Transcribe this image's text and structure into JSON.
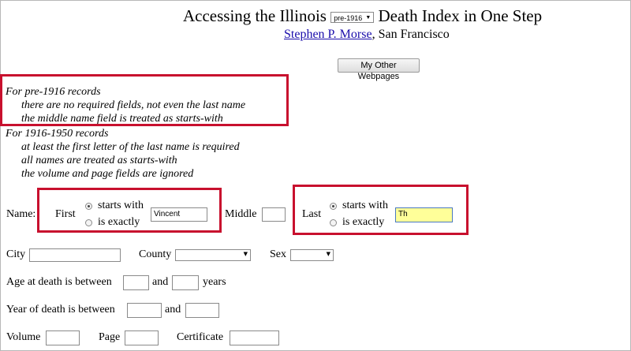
{
  "header": {
    "title_prefix": "Accessing the Illinois",
    "period_select": "pre-1916",
    "title_suffix": "Death Index in One Step",
    "author_link": "Stephen P. Morse",
    "author_location": ", San Francisco",
    "other_pages_button": "My Other Webpages"
  },
  "notes": {
    "pre1916_heading": "For pre-1916 records",
    "pre1916_lines": [
      "there are no required fields, not even the last name",
      "the middle name field is treated as starts-with"
    ],
    "r1916_heading": "For 1916-1950 records",
    "r1916_lines": [
      "at least the first letter of the last name is required",
      "all names are treated as starts-with",
      "the volume and page fields are ignored"
    ]
  },
  "form": {
    "name_label": "Name:",
    "first_label": "First",
    "starts_with": "starts with",
    "is_exactly": "is exactly",
    "first_value": "Vincent",
    "middle_label": "Middle",
    "middle_value": "",
    "last_label": "Last",
    "last_value": "Th",
    "city_label": "City",
    "county_label": "County",
    "county_value": "",
    "sex_label": "Sex",
    "sex_value": "",
    "age_label": "Age at death is between",
    "and_label": "and",
    "years_label": "years",
    "year_label": "Year of death is between",
    "volume_label": "Volume",
    "page_label": "Page",
    "certificate_label": "Certificate"
  },
  "colors": {
    "highlight_border": "#c8102e",
    "active_field_bg": "#ffff99",
    "link": "#1a0dab"
  }
}
